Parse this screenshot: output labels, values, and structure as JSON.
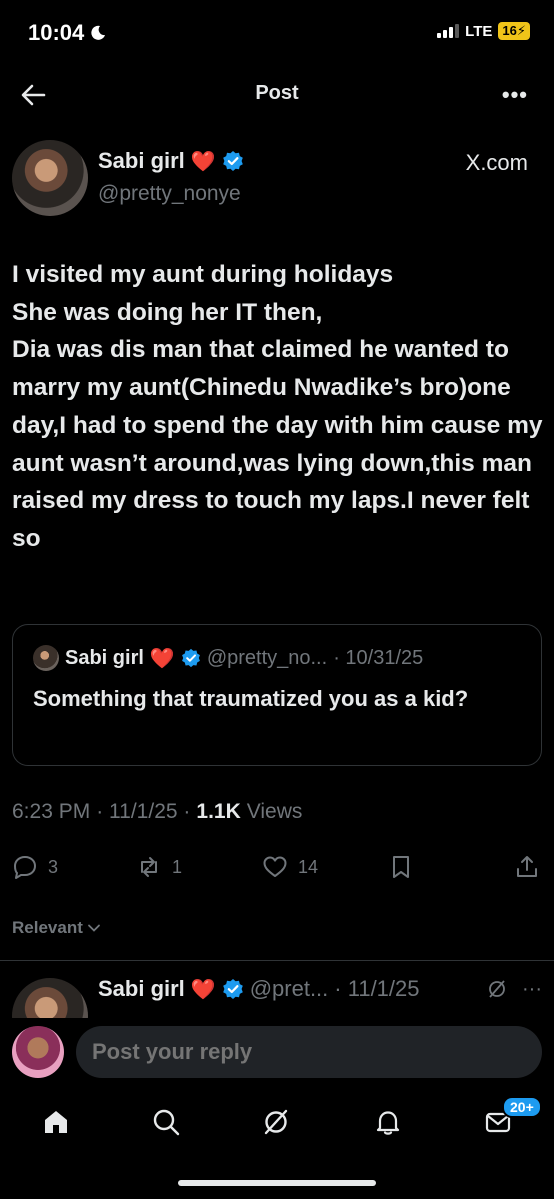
{
  "status": {
    "time": "10:04",
    "network": "LTE",
    "battery": "16"
  },
  "nav": {
    "title": "Post"
  },
  "post": {
    "author_name": "Sabi girl",
    "author_handle": "@pretty_nonye",
    "source": "X.com",
    "text": "I visited my aunt during holidays\nShe was doing her IT then,\nDia was dis man that claimed he wanted to marry my aunt(Chinedu Nwadike’s bro)one day,I had to spend the day with him cause my aunt wasn’t around,was lying down,this man raised my dress to touch my laps.I never felt so",
    "quote": {
      "name": "Sabi girl",
      "handle": "@pretty_no...",
      "date": "· 10/31/25",
      "text": "Something that traumatized you as a kid?"
    },
    "meta": {
      "time": "6:23 PM",
      "date": "· 11/1/25 ·",
      "views_count": "1.1K",
      "views_label": "Views"
    },
    "stats": {
      "replies": "3",
      "reposts": "1",
      "likes": "14"
    }
  },
  "sort": {
    "label": "Relevant"
  },
  "reply": {
    "name": "Sabi girl",
    "handle": "@pret...",
    "date": "· 11/1/25"
  },
  "composer": {
    "placeholder": "Post your reply"
  },
  "tabbar": {
    "messages_badge": "20+"
  },
  "colors": {
    "background": "#000000",
    "text": "#e7e9ea",
    "muted": "#71767b",
    "verified": "#1d9bf0",
    "heart": "#e0202f"
  }
}
